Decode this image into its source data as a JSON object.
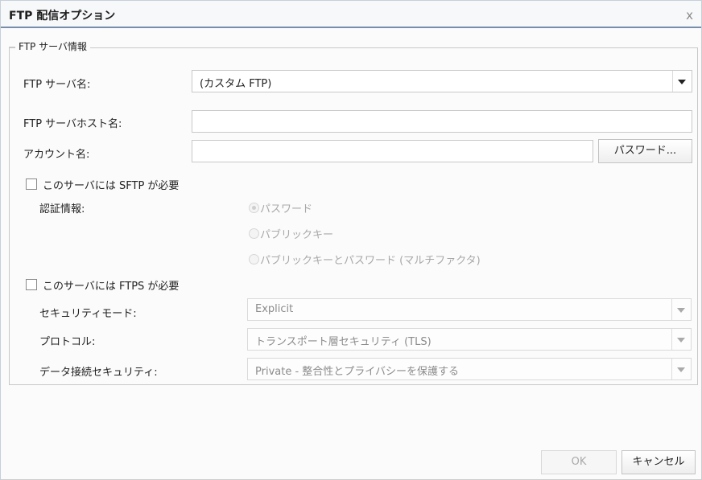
{
  "dialog": {
    "title": "FTP 配信オプション",
    "close_glyph": "x"
  },
  "server_group": {
    "legend": "FTP サーバ情報",
    "server_name_label": "FTP サーバ名:",
    "server_name_value": "(カスタム FTP)",
    "host_label": "FTP サーバホスト名:",
    "host_value": "",
    "account_label": "アカウント名:",
    "account_value": "",
    "password_button": "パスワード..."
  },
  "sftp": {
    "checkbox_label": "このサーバには SFTP が必要",
    "checked": false,
    "auth_label": "認証情報:",
    "options": [
      {
        "label": "パスワード",
        "selected": true
      },
      {
        "label": "パブリックキー",
        "selected": false
      },
      {
        "label": "パブリックキーとパスワード (マルチファクタ)",
        "selected": false
      }
    ]
  },
  "ftps": {
    "checkbox_label": "このサーバには FTPS が必要",
    "checked": false,
    "security_mode_label": "セキュリティモード:",
    "security_mode_value": "Explicit",
    "protocol_label": "プロトコル:",
    "protocol_value": "トランスポート層セキュリティ (TLS)",
    "data_security_label": "データ接続セキュリティ:",
    "data_security_value": "Private - 整合性とプライバシーを保護する"
  },
  "footer": {
    "ok_label": "OK",
    "cancel_label": "キャンセル"
  }
}
